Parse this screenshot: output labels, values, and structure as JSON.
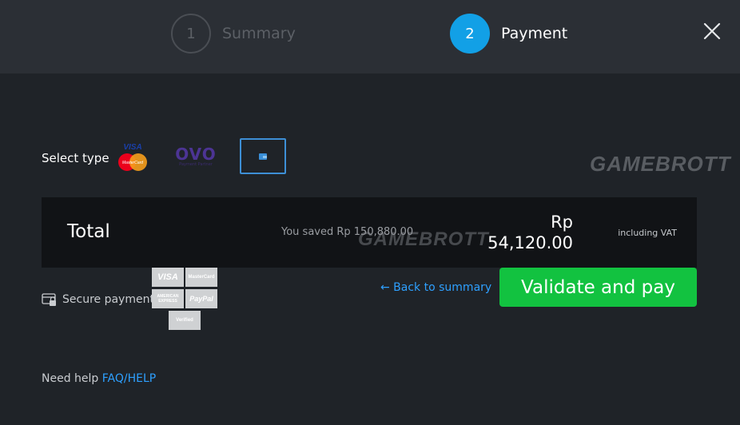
{
  "steps": [
    {
      "number": "1",
      "label": "Summary"
    },
    {
      "number": "2",
      "label": "Payment"
    }
  ],
  "select_type": {
    "label": "Select type",
    "options": [
      {
        "name": "card",
        "brand_top": "VISA",
        "brand_bottom": "MasterCard"
      },
      {
        "name": "ovo",
        "brand": "OVO",
        "sub": "Payment Partner"
      },
      {
        "name": "wallet",
        "selected": true
      }
    ]
  },
  "watermark": "GAMEBROTT",
  "total": {
    "label": "Total",
    "saved": "You saved Rp 150,880.00",
    "currency": "Rp",
    "amount": "54,120.00",
    "vat": "including VAT"
  },
  "secure": {
    "label": "Secure payment",
    "logos": [
      "VISA",
      "MasterCard",
      "AMERICAN EXPRESS",
      "PayPal",
      "Verified"
    ]
  },
  "actions": {
    "back": "← Back to summary",
    "validate": "Validate and pay"
  },
  "help": {
    "text": "Need help",
    "link": "FAQ/HELP"
  },
  "colors": {
    "accent_blue": "#12a0e6",
    "link_blue": "#2ea0ff",
    "validate_green": "#12c240",
    "background": "#1f2328"
  }
}
